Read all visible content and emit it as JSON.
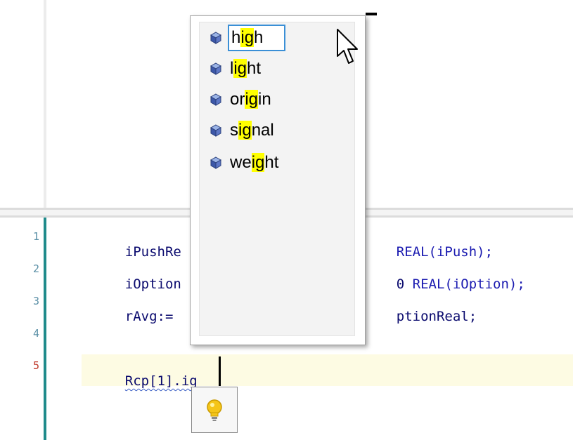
{
  "autocomplete": {
    "items": [
      {
        "pre": "h",
        "hl": "ig",
        "post": "h",
        "selected": true
      },
      {
        "pre": "l",
        "hl": "ig",
        "post": "ht",
        "selected": false
      },
      {
        "pre": "or",
        "hl": "ig",
        "post": "in",
        "selected": false
      },
      {
        "pre": "s",
        "hl": "ig",
        "post": "nal",
        "selected": false
      },
      {
        "pre": "we",
        "hl": "ig",
        "post": "ht",
        "selected": false
      }
    ],
    "item_icon": "cube-icon"
  },
  "editor": {
    "line_numbers": [
      "1",
      "2",
      "3",
      "4",
      "5"
    ],
    "lines": [
      {
        "a": "iPushRe",
        "b": "REAL(iPush);"
      },
      {
        "a": "iOption",
        "b": "REAL(iOption);"
      },
      {
        "a": "rAvg:=",
        "b": "ptionReal;"
      },
      {
        "a": "",
        "b": ""
      },
      {
        "a": "Rcp[1].ig",
        "b": ""
      }
    ],
    "line2_frag": "0 ",
    "current_line": "5",
    "current_line_color": "#c0392b",
    "gutter_color": "#1f8b8b",
    "quick_action_icon": "lightbulb-icon"
  }
}
